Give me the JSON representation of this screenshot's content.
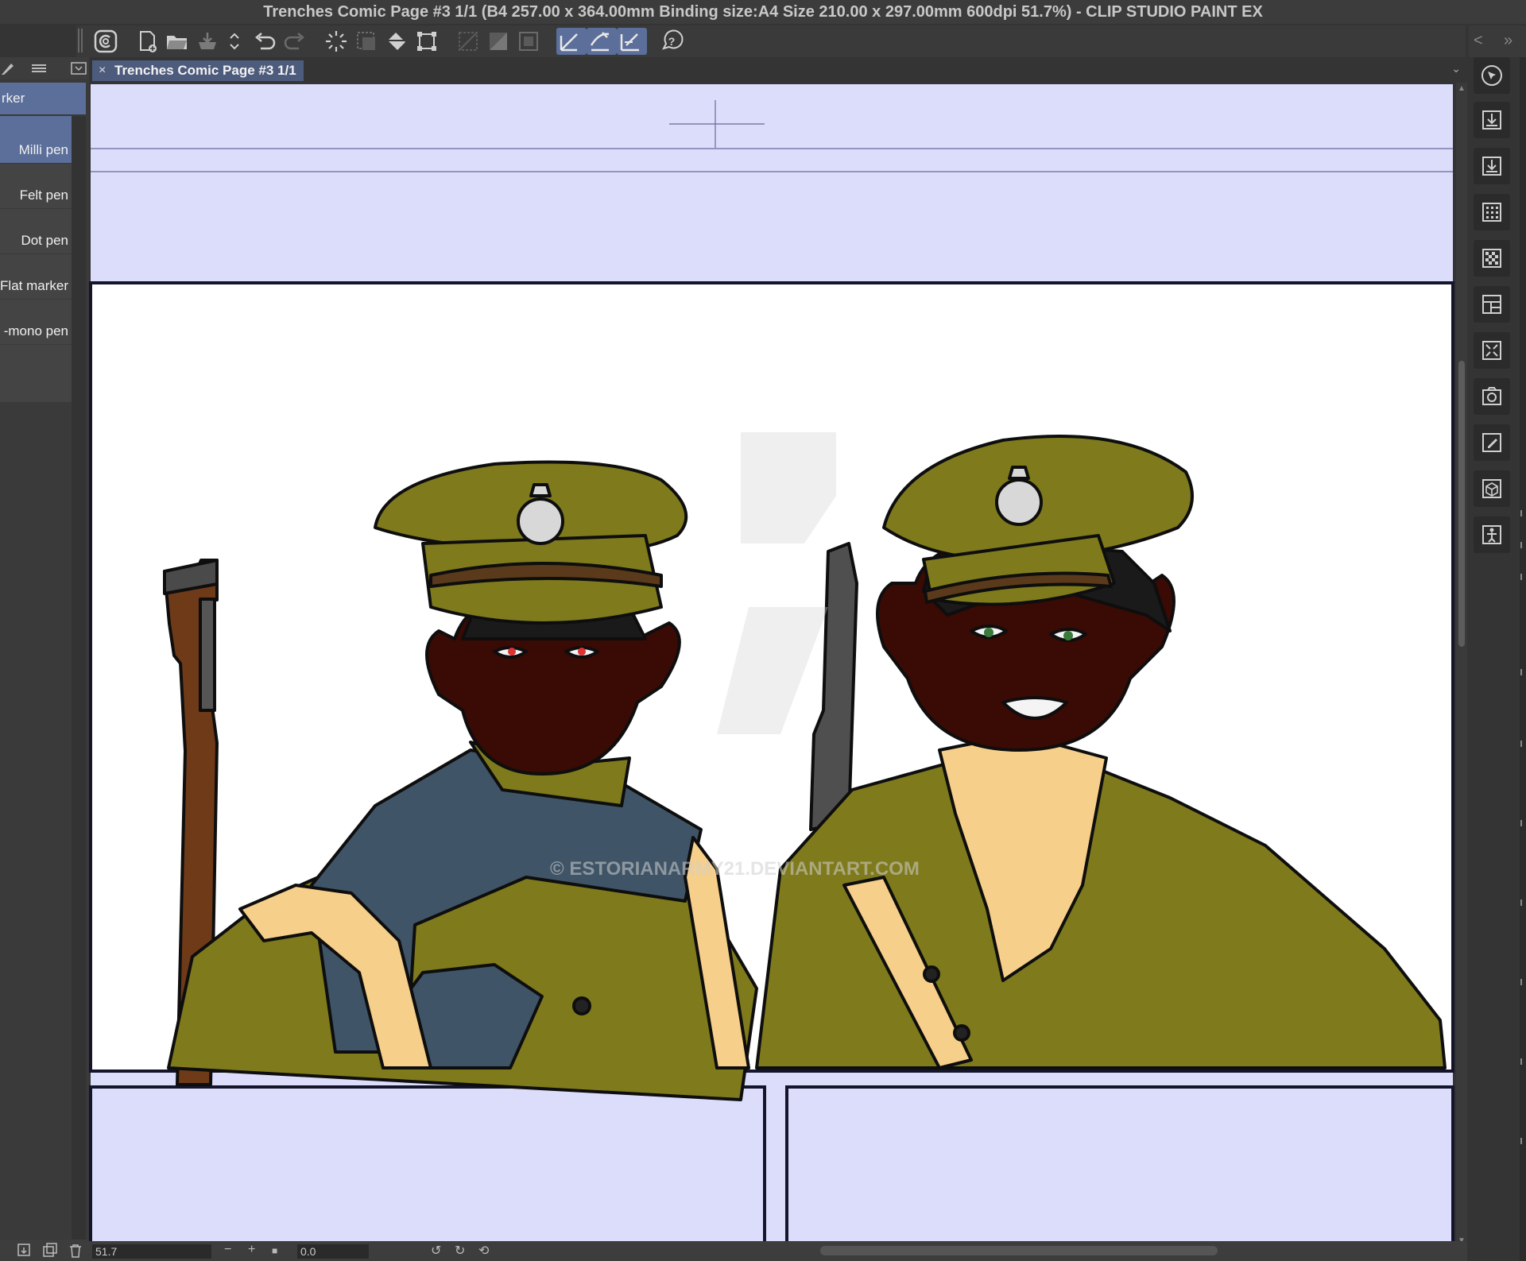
{
  "window": {
    "title": "Trenches Comic Page #3 1/1 (B4 257.00 x 364.00mm Binding size:A4 Size 210.00 x 297.00mm 600dpi 51.7%)  - CLIP STUDIO PAINT EX"
  },
  "command_bar": {
    "icons": [
      "clip-studio-icon",
      "new-file-icon",
      "open-file-icon",
      "save-icon",
      "stepper-icon",
      "undo-icon",
      "redo-icon",
      "selection-launcher-icon",
      "clear-selection-icon",
      "fill-icon",
      "transform-icon",
      "hide-border-icon",
      "invert-selection-icon",
      "convert-selection-icon",
      "snap-ruler-icon",
      "snap-special-ruler-icon",
      "snap-grid-icon",
      "help-icon"
    ],
    "active_icons": [
      "snap-ruler-icon",
      "snap-special-ruler-icon",
      "snap-grid-icon"
    ],
    "arrows_left": "<",
    "arrows_right": "»"
  },
  "subtool_palette": {
    "group_tab_label": "rker",
    "items": [
      {
        "label": "Milli pen",
        "selected": true
      },
      {
        "label": "Felt pen",
        "selected": false
      },
      {
        "label": "Dot pen",
        "selected": false
      },
      {
        "label": "Flat marker",
        "selected": false
      },
      {
        "label": "-mono pen",
        "selected": false
      }
    ]
  },
  "document_tab": {
    "close": "×",
    "label": "Trenches Comic Page #3 1/1",
    "dropdown": "⌄"
  },
  "canvas": {
    "page_color": "#dcdcfb",
    "panel_color": "#ffffff",
    "border_color": "#14142a",
    "watermark": "© ESTORIANARMY21.DEVIANTART.COM",
    "uniform_color": "#7f7a1c",
    "scarf_color": "#3f5466",
    "skin_color": "#3a0a04",
    "scarf2_color": "#f6cf8a"
  },
  "statusbar": {
    "zoom": "51.7",
    "zoom_out": "−",
    "zoom_in": "+",
    "fit": "■",
    "angle": "0.0",
    "rotate_left": "↺",
    "rotate_right": "↻",
    "reset": "⟲"
  },
  "right_palette": {
    "icons": [
      "navigator-icon",
      "import-icon",
      "export-icon",
      "grid-icon",
      "checker-icon",
      "layout-icon",
      "frame-icon",
      "camera-icon",
      "edit-icon",
      "3d-box-icon",
      "pose-icon"
    ]
  }
}
